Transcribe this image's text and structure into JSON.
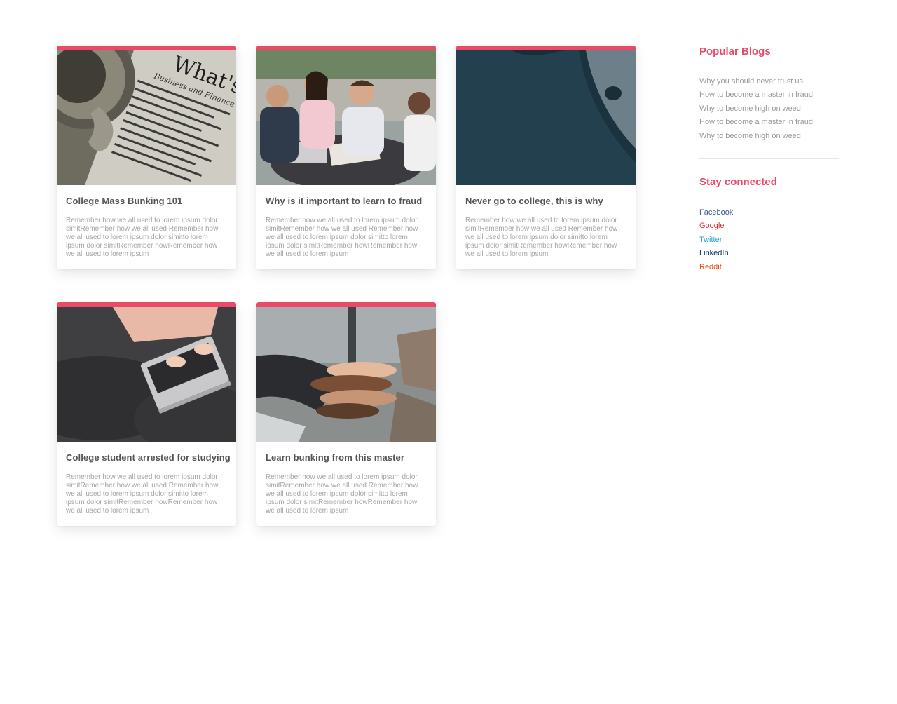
{
  "posts": [
    {
      "title": "College Mass Bunking 101",
      "excerpt": "Remember how we all used to lorem ipsum dolor simitRemember how we all used Remember how we all used to lorem ipsum dolor simitto lorem ipsum dolor simitRemember howRemember how we all used to lorem ipsum",
      "image": "newspaper-coffee-photo",
      "image_text": "What's N"
    },
    {
      "title": "Why is it important to learn to fraud",
      "excerpt": "Remember how we all used to lorem ipsum dolor simitRemember how we all used Remember how we all used to lorem ipsum dolor simitto lorem ipsum dolor simitRemember howRemember how we all used to lorem ipsum",
      "image": "students-table-photo"
    },
    {
      "title": "Never go to college, this is why",
      "excerpt": "Remember how we all used to lorem ipsum dolor simitRemember how we all used Remember how we all used to lorem ipsum dolor simitto lorem ipsum dolor simitRemember howRemember how we all used to lorem ipsum",
      "image": "dark-teal-abstract-illustration"
    },
    {
      "title": "College student arrested for studying",
      "excerpt": "Remember how we all used to lorem ipsum dolor simitRemember how we all used Remember how we all used to lorem ipsum dolor simitto lorem ipsum dolor simitRemember howRemember how we all used to lorem ipsum",
      "image": "laptop-typing-photo"
    },
    {
      "title": "Learn bunking from this master",
      "excerpt": "Remember how we all used to lorem ipsum dolor simitRemember how we all used Remember how we all used to lorem ipsum dolor simitto lorem ipsum dolor simitRemember howRemember how we all used to lorem ipsum",
      "image": "stacked-hands-photo"
    }
  ],
  "sidebar": {
    "popular_title": "Popular Blogs",
    "popular": [
      "Why you should never trust us",
      "How to become a master in fraud",
      "Why to become high on weed",
      "How to become a master in fraud",
      "Why to become high on weed"
    ],
    "connected_title": "Stay connected",
    "social": [
      {
        "label": "Facebook",
        "color": "#3b5998"
      },
      {
        "label": "Google",
        "color": "#dd2c2c"
      },
      {
        "label": "Twitter",
        "color": "#1da1c4"
      },
      {
        "label": "LinkedIn",
        "color": "#0e3561"
      },
      {
        "label": "Reddit",
        "color": "#ec4a10"
      }
    ]
  },
  "colors": {
    "accent": "#e84a68",
    "title": "#555555",
    "muted": "#a5a5a5"
  }
}
